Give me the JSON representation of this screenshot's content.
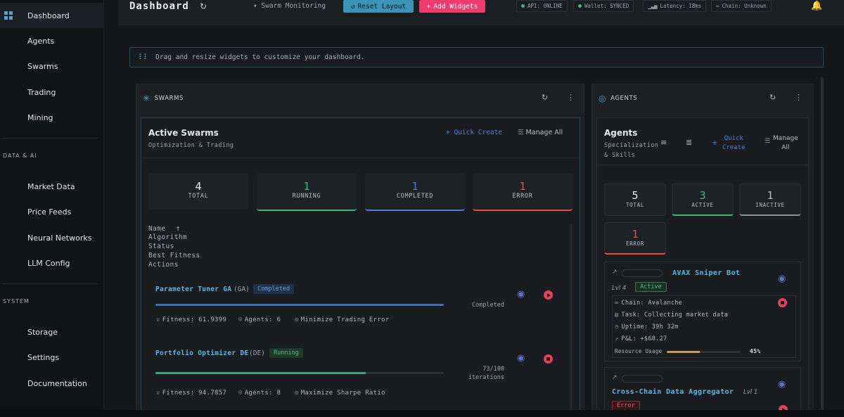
{
  "sidebar": {
    "items_top": [
      {
        "label": "Dashboard",
        "icon": "dashboard-grid-icon"
      },
      {
        "label": "Agents"
      },
      {
        "label": "Swarms"
      },
      {
        "label": "Trading"
      },
      {
        "label": "Mining"
      }
    ],
    "section_data": "DATA & AI",
    "items_data": [
      {
        "label": "Market Data"
      },
      {
        "label": "Price Feeds"
      },
      {
        "label": "Neural Networks"
      },
      {
        "label": "LLM Config"
      }
    ],
    "section_system": "SYSTEM",
    "items_system": [
      {
        "label": "Storage"
      },
      {
        "label": "Settings"
      },
      {
        "label": "Documentation"
      }
    ]
  },
  "header": {
    "title": "Dashboard",
    "swarm_select": "Swarm Monitoring",
    "reset_label": "Reset Layout",
    "add_label": "Add Widgets",
    "chips": {
      "api": "API: ONLINE",
      "wallet": "Wallet: SYNCED",
      "latency": "Latency: 18ms",
      "chain": "Chain: Unknown"
    }
  },
  "info_bar": {
    "text": "Drag and resize widgets to customize your dashboard."
  },
  "swarms_widget": {
    "title": "SWARMS",
    "panel_title": "Active Swarms",
    "panel_subtitle": "Optimization & Trading",
    "quick_create": "Quick Create",
    "manage_all": "Manage All",
    "stats": [
      {
        "value": "4",
        "label": "TOTAL",
        "color": "#e8eaec"
      },
      {
        "value": "1",
        "label": "RUNNING",
        "color": "#3fb57c"
      },
      {
        "value": "1",
        "label": "COMPLETED",
        "color": "#4c7fd0"
      },
      {
        "value": "1",
        "label": "ERROR",
        "color": "#e0514e"
      }
    ],
    "columns": [
      "Name",
      "Algorithm",
      "Status",
      "Best Fitness",
      "Actions"
    ],
    "rows": [
      {
        "name": "Parameter Tuner GA",
        "algo": "(GA)",
        "status": "Completed",
        "progress": 1.0,
        "status_text": "Completed",
        "fitness": "Fitness: 61.9399",
        "agents": "Agents: 6",
        "objective": "Minimize Trading Error"
      },
      {
        "name": "Portfolio Optimizer DE",
        "algo": "(DE)",
        "status": "Running",
        "progress": 0.73,
        "status_text": "73/100",
        "status_text2": "iterations",
        "fitness": "Fitness: 94.7857",
        "agents": "Agents: 8",
        "objective": "Maximize Sharpe Ratio"
      }
    ]
  },
  "agents_widget": {
    "title": "AGENTS",
    "panel_title": "Agents",
    "panel_subtitle_1": "Specialization",
    "panel_subtitle_2": "& Skills",
    "quick_create_1": "Quick",
    "quick_create_2": "Create",
    "manage_1": "Manage",
    "manage_2": "All",
    "stats": [
      {
        "value": "5",
        "label": "TOTAL",
        "color": "#e8eaec"
      },
      {
        "value": "3",
        "label": "ACTIVE",
        "color": "#3fb57c"
      },
      {
        "value": "1",
        "label": "INACTIVE",
        "color": "#b7bbbf"
      },
      {
        "value": "1",
        "label": "ERROR",
        "color": "#e0514e"
      }
    ],
    "cards": [
      {
        "name": "AVAX Sniper Bot",
        "level": "Lvl 4",
        "status": "Active",
        "chain": "Chain: Avalanche",
        "task": "Task: Collecting market data",
        "uptime": "Uptime: 39h 32m",
        "pnl": "P&L: +$68.27",
        "resource_label": "Resource Usage",
        "resource_value": "45%",
        "resource": 0.45
      },
      {
        "name": "Cross-Chain Data Aggregator",
        "level": "Lvl 1",
        "status": "Error"
      }
    ]
  }
}
